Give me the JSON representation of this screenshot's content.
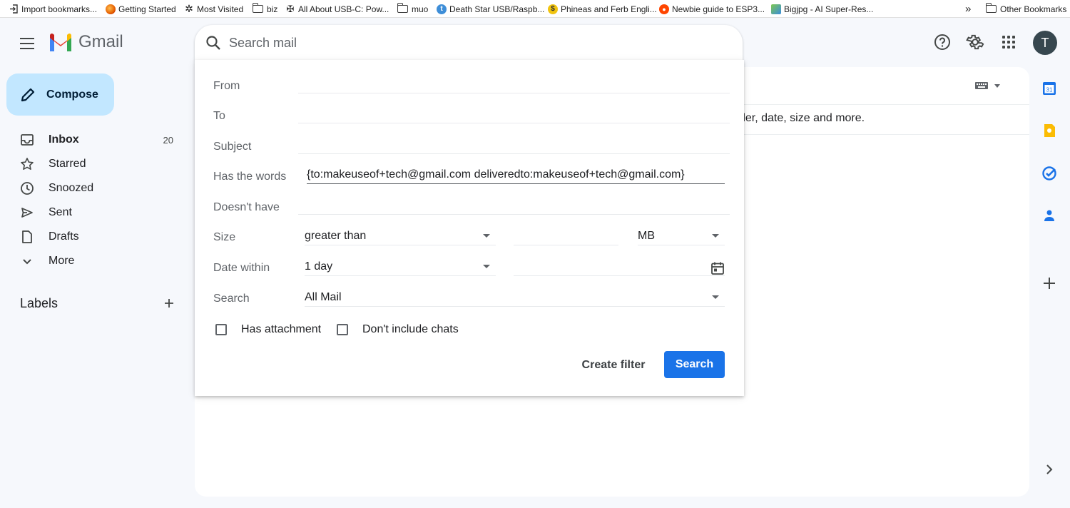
{
  "bookmarks": {
    "items": [
      {
        "label": "Import bookmarks...",
        "icon": "import-icon"
      },
      {
        "label": "Getting Started",
        "icon": "firefox-icon"
      },
      {
        "label": "Most Visited",
        "icon": "gear-icon"
      },
      {
        "label": "biz",
        "icon": "folder-icon"
      },
      {
        "label": "All About USB-C: Pow...",
        "icon": "hackaday-icon"
      },
      {
        "label": "muo",
        "icon": "folder-icon"
      },
      {
        "label": "Death Star USB/Raspb...",
        "icon": "tumblr-icon"
      },
      {
        "label": "Phineas and Ferb Engli...",
        "icon": "coin-icon"
      },
      {
        "label": "Newbie guide to ESP3...",
        "icon": "reddit-icon"
      },
      {
        "label": "Bigjpg - AI Super-Res...",
        "icon": "bigjpg-icon"
      }
    ],
    "overflow_icon": "chevron-double-right-icon",
    "other": "Other Bookmarks"
  },
  "app": {
    "name": "Gmail",
    "avatar_letter": "T"
  },
  "search": {
    "placeholder": "Search mail"
  },
  "sidebar": {
    "compose_label": "Compose",
    "items": [
      {
        "label": "Inbox",
        "count": "20",
        "icon": "inbox-icon"
      },
      {
        "label": "Starred",
        "icon": "star-icon"
      },
      {
        "label": "Snoozed",
        "icon": "clock-icon"
      },
      {
        "label": "Sent",
        "icon": "send-icon"
      },
      {
        "label": "Drafts",
        "icon": "draft-icon"
      },
      {
        "label": "More",
        "icon": "chevron-down-icon"
      }
    ],
    "labels_title": "Labels"
  },
  "main": {
    "hint": "der, date, size and more."
  },
  "filter": {
    "from_label": "From",
    "to_label": "To",
    "subject_label": "Subject",
    "has_words_label": "Has the words",
    "has_words_value": "{to:makeuseof+tech@gmail.com deliveredto:makeuseof+tech@gmail.com}",
    "doesnt_have_label": "Doesn't have",
    "size_label": "Size",
    "size_operator": "greater than",
    "size_unit": "MB",
    "date_label": "Date within",
    "date_value": "1 day",
    "search_label": "Search",
    "search_value": "All Mail",
    "has_attachment": "Has attachment",
    "dont_include_chats": "Don't include chats",
    "create_filter": "Create filter",
    "search_button": "Search"
  },
  "colors": {
    "accent": "#1a73e8",
    "compose_bg": "#c2e7ff",
    "page_bg": "#f6f8fc"
  }
}
